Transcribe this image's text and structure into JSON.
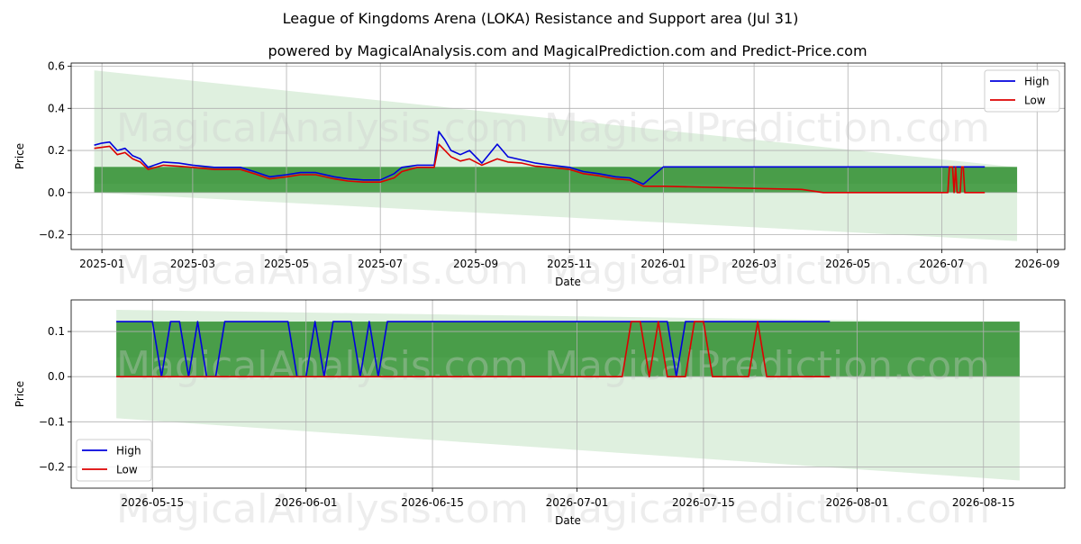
{
  "chart_title": "League of Kingdoms Arena (LOKA) Resistance and Support area (Jul 31)",
  "chart_subtitle": "powered by MagicalAnalysis.com and MagicalPrediction.com and Predict-Price.com",
  "watermarks": [
    "MagicalAnalysis.com",
    "MagicalPrediction.com"
  ],
  "colors": {
    "high": "#0000dd",
    "low": "#dd0000",
    "band_dark": "#3c963c",
    "band_light": "#d4ebd4",
    "grid": "#b0b0b0"
  },
  "chart_data": [
    {
      "type": "line",
      "xlabel": "Date",
      "ylabel": "Price",
      "x_ticks": [
        "2025-01",
        "2025-03",
        "2025-05",
        "2025-07",
        "2025-09",
        "2025-11",
        "2026-01",
        "2026-03",
        "2026-05",
        "2026-07",
        "2026-09"
      ],
      "y_ticks": [
        "−0.2",
        "0.0",
        "0.2",
        "0.4",
        "0.6"
      ],
      "xlim": [
        "2024-12-12",
        "2026-09-19"
      ],
      "ylim": [
        -0.27,
        0.615
      ],
      "legend": {
        "position": "top-right",
        "entries": [
          "High",
          "Low"
        ]
      },
      "grid": true,
      "resistance_support_band": {
        "start": "2024-12-27",
        "end": "2026-08-19",
        "upper": 0.122,
        "lower": 0.0
      },
      "forecast_cone": {
        "start": "2024-12-27",
        "end": "2026-08-19",
        "upper_start": 0.58,
        "upper_end": 0.12,
        "lower_start": 0.0,
        "lower_end": -0.23
      },
      "series": [
        {
          "name": "High",
          "color": "#0000dd",
          "points": [
            [
              "2024-12-27",
              0.225
            ],
            [
              "2025-01-01",
              0.235
            ],
            [
              "2025-01-06",
              0.24
            ],
            [
              "2025-01-11",
              0.2
            ],
            [
              "2025-01-16",
              0.21
            ],
            [
              "2025-01-21",
              0.175
            ],
            [
              "2025-01-26",
              0.16
            ],
            [
              "2025-01-31",
              0.12
            ],
            [
              "2025-02-10",
              0.145
            ],
            [
              "2025-02-20",
              0.14
            ],
            [
              "2025-03-01",
              0.13
            ],
            [
              "2025-03-15",
              0.12
            ],
            [
              "2025-04-01",
              0.12
            ],
            [
              "2025-04-10",
              0.1
            ],
            [
              "2025-04-20",
              0.075
            ],
            [
              "2025-05-01",
              0.085
            ],
            [
              "2025-05-10",
              0.095
            ],
            [
              "2025-05-20",
              0.095
            ],
            [
              "2025-06-01",
              0.075
            ],
            [
              "2025-06-10",
              0.065
            ],
            [
              "2025-06-20",
              0.06
            ],
            [
              "2025-07-01",
              0.06
            ],
            [
              "2025-07-10",
              0.09
            ],
            [
              "2025-07-15",
              0.12
            ],
            [
              "2025-07-25",
              0.13
            ],
            [
              "2025-08-05",
              0.13
            ],
            [
              "2025-08-08",
              0.29
            ],
            [
              "2025-08-12",
              0.25
            ],
            [
              "2025-08-16",
              0.2
            ],
            [
              "2025-08-22",
              0.18
            ],
            [
              "2025-08-28",
              0.2
            ],
            [
              "2025-09-05",
              0.14
            ],
            [
              "2025-09-15",
              0.23
            ],
            [
              "2025-09-22",
              0.17
            ],
            [
              "2025-10-01",
              0.155
            ],
            [
              "2025-10-10",
              0.14
            ],
            [
              "2025-10-20",
              0.13
            ],
            [
              "2025-11-01",
              0.12
            ],
            [
              "2025-11-10",
              0.1
            ],
            [
              "2025-11-20",
              0.09
            ],
            [
              "2025-12-01",
              0.075
            ],
            [
              "2025-12-10",
              0.07
            ],
            [
              "2025-12-19",
              0.04
            ],
            [
              "2026-01-01",
              0.122
            ],
            [
              "2026-02-01",
              0.122
            ],
            [
              "2026-03-01",
              0.122
            ],
            [
              "2026-04-01",
              0.122
            ],
            [
              "2026-05-01",
              0.122
            ],
            [
              "2026-06-01",
              0.122
            ],
            [
              "2026-07-01",
              0.122
            ],
            [
              "2026-07-29",
              0.122
            ]
          ]
        },
        {
          "name": "Low",
          "color": "#dd0000",
          "points": [
            [
              "2024-12-27",
              0.21
            ],
            [
              "2025-01-01",
              0.215
            ],
            [
              "2025-01-06",
              0.22
            ],
            [
              "2025-01-11",
              0.18
            ],
            [
              "2025-01-16",
              0.19
            ],
            [
              "2025-01-21",
              0.16
            ],
            [
              "2025-01-26",
              0.145
            ],
            [
              "2025-01-31",
              0.11
            ],
            [
              "2025-02-10",
              0.13
            ],
            [
              "2025-02-20",
              0.125
            ],
            [
              "2025-03-01",
              0.12
            ],
            [
              "2025-03-15",
              0.11
            ],
            [
              "2025-04-01",
              0.11
            ],
            [
              "2025-04-10",
              0.09
            ],
            [
              "2025-04-20",
              0.065
            ],
            [
              "2025-05-01",
              0.075
            ],
            [
              "2025-05-10",
              0.085
            ],
            [
              "2025-05-20",
              0.085
            ],
            [
              "2025-06-01",
              0.065
            ],
            [
              "2025-06-10",
              0.055
            ],
            [
              "2025-06-20",
              0.05
            ],
            [
              "2025-07-01",
              0.05
            ],
            [
              "2025-07-10",
              0.07
            ],
            [
              "2025-07-15",
              0.1
            ],
            [
              "2025-07-25",
              0.12
            ],
            [
              "2025-08-05",
              0.12
            ],
            [
              "2025-08-08",
              0.23
            ],
            [
              "2025-08-12",
              0.2
            ],
            [
              "2025-08-16",
              0.17
            ],
            [
              "2025-08-22",
              0.15
            ],
            [
              "2025-08-28",
              0.16
            ],
            [
              "2025-09-05",
              0.13
            ],
            [
              "2025-09-15",
              0.16
            ],
            [
              "2025-09-22",
              0.145
            ],
            [
              "2025-10-01",
              0.14
            ],
            [
              "2025-10-10",
              0.125
            ],
            [
              "2025-10-20",
              0.12
            ],
            [
              "2025-11-01",
              0.11
            ],
            [
              "2025-11-10",
              0.09
            ],
            [
              "2025-11-20",
              0.08
            ],
            [
              "2025-12-01",
              0.065
            ],
            [
              "2025-12-10",
              0.06
            ],
            [
              "2025-12-19",
              0.03
            ],
            [
              "2026-01-01",
              0.03
            ],
            [
              "2026-02-01",
              0.025
            ],
            [
              "2026-03-01",
              0.02
            ],
            [
              "2026-04-01",
              0.015
            ],
            [
              "2026-04-15",
              0.0
            ],
            [
              "2026-07-05",
              0.0
            ],
            [
              "2026-07-06",
              0.122
            ],
            [
              "2026-07-08",
              0.122
            ],
            [
              "2026-07-09",
              0.0
            ],
            [
              "2026-07-10",
              0.122
            ],
            [
              "2026-07-11",
              0.0
            ],
            [
              "2026-07-13",
              0.0
            ],
            [
              "2026-07-14",
              0.122
            ],
            [
              "2026-07-15",
              0.122
            ],
            [
              "2026-07-16",
              0.0
            ],
            [
              "2026-07-29",
              0.0
            ]
          ]
        }
      ]
    },
    {
      "type": "line",
      "xlabel": "Date",
      "ylabel": "Price",
      "x_ticks": [
        "2026-05-15",
        "2026-06-01",
        "2026-06-15",
        "2026-07-01",
        "2026-07-15",
        "2026-08-01",
        "2026-08-15"
      ],
      "y_ticks": [
        "−0.2",
        "−0.1",
        "0.0",
        "0.1"
      ],
      "xlim": [
        "2026-05-06",
        "2026-08-24"
      ],
      "ylim": [
        -0.247,
        0.17
      ],
      "legend": {
        "position": "bottom-left",
        "entries": [
          "High",
          "Low"
        ]
      },
      "grid": true,
      "resistance_support_band": {
        "start": "2026-05-11",
        "end": "2026-08-19",
        "upper": 0.122,
        "lower": 0.0
      },
      "forecast_cone": {
        "start": "2026-05-11",
        "end": "2026-08-19",
        "upper_start": 0.148,
        "upper_end": 0.12,
        "lower_start": -0.092,
        "lower_end": -0.23
      },
      "series": [
        {
          "name": "High",
          "color": "#0000dd",
          "points": [
            [
              "2026-05-11",
              0.122
            ],
            [
              "2026-05-15",
              0.122
            ],
            [
              "2026-05-16",
              0.0
            ],
            [
              "2026-05-17",
              0.122
            ],
            [
              "2026-05-18",
              0.122
            ],
            [
              "2026-05-19",
              0.0
            ],
            [
              "2026-05-20",
              0.122
            ],
            [
              "2026-05-21",
              0.0
            ],
            [
              "2026-05-22",
              0.0
            ],
            [
              "2026-05-23",
              0.122
            ],
            [
              "2026-05-30",
              0.122
            ],
            [
              "2026-05-31",
              0.0
            ],
            [
              "2026-06-01",
              0.0
            ],
            [
              "2026-06-02",
              0.122
            ],
            [
              "2026-06-03",
              0.0
            ],
            [
              "2026-06-04",
              0.122
            ],
            [
              "2026-06-06",
              0.122
            ],
            [
              "2026-06-07",
              0.0
            ],
            [
              "2026-06-08",
              0.122
            ],
            [
              "2026-06-09",
              0.0
            ],
            [
              "2026-06-10",
              0.122
            ],
            [
              "2026-07-11",
              0.122
            ],
            [
              "2026-07-12",
              0.0
            ],
            [
              "2026-07-13",
              0.122
            ],
            [
              "2026-07-29",
              0.122
            ]
          ]
        },
        {
          "name": "Low",
          "color": "#dd0000",
          "points": [
            [
              "2026-05-11",
              0.0
            ],
            [
              "2026-07-06",
              0.0
            ],
            [
              "2026-07-07",
              0.122
            ],
            [
              "2026-07-08",
              0.122
            ],
            [
              "2026-07-09",
              0.0
            ],
            [
              "2026-07-10",
              0.122
            ],
            [
              "2026-07-11",
              0.0
            ],
            [
              "2026-07-13",
              0.0
            ],
            [
              "2026-07-14",
              0.122
            ],
            [
              "2026-07-15",
              0.122
            ],
            [
              "2026-07-16",
              0.0
            ],
            [
              "2026-07-20",
              0.0
            ],
            [
              "2026-07-21",
              0.122
            ],
            [
              "2026-07-22",
              0.0
            ],
            [
              "2026-07-29",
              0.0
            ]
          ]
        }
      ]
    }
  ]
}
